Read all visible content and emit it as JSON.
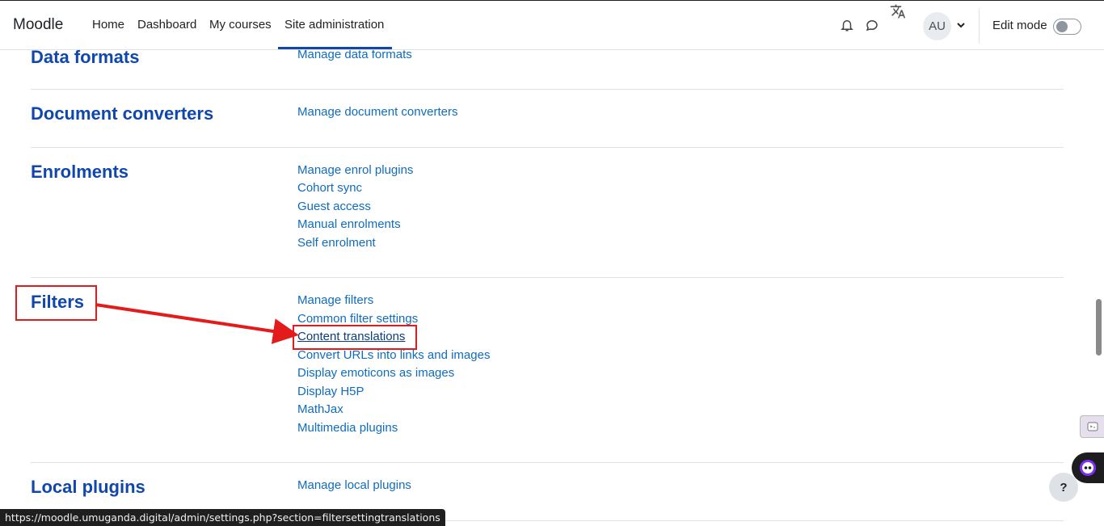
{
  "navbar": {
    "brand": "Moodle",
    "links": [
      "Home",
      "Dashboard",
      "My courses",
      "Site administration"
    ],
    "active_link": "Site administration",
    "avatar_initials": "AU",
    "edit_mode_label": "Edit mode",
    "edit_mode_on": false
  },
  "sections": [
    {
      "title": "Data formats",
      "links": [
        "Manage data formats"
      ]
    },
    {
      "title": "Document converters",
      "links": [
        "Manage document converters"
      ]
    },
    {
      "title": "Enrolments",
      "links": [
        "Manage enrol plugins",
        "Cohort sync",
        "Guest access",
        "Manual enrolments",
        "Self enrolment"
      ]
    },
    {
      "title": "Filters",
      "links": [
        "Manage filters",
        "Common filter settings",
        "Content translations",
        "Convert URLs into links and images",
        "Display emoticons as images",
        "Display H5P",
        "MathJax",
        "Multimedia plugins"
      ]
    },
    {
      "title": "Local plugins",
      "links": [
        "Manage local plugins"
      ]
    }
  ],
  "highlighted_link": "Content translations",
  "annotation_color": "#e31b1b",
  "accent_color": "#0f47ad",
  "status_url": "https://moodle.umuganda.digital/admin/settings.php?section=filtersettingtranslations",
  "help_label": "?"
}
